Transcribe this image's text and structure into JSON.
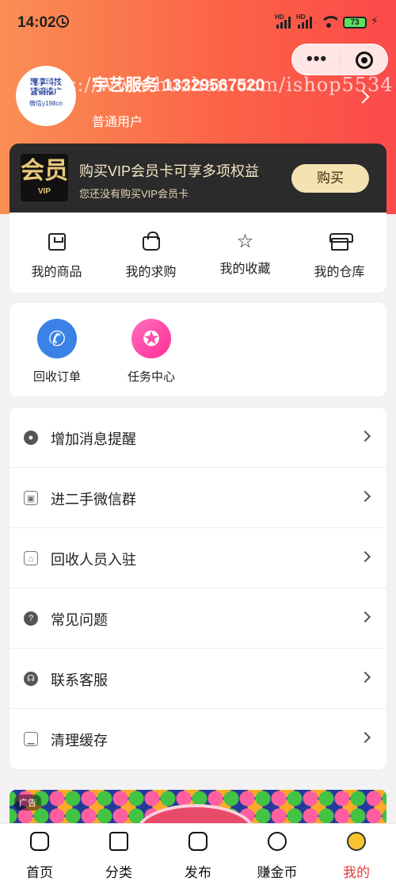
{
  "status_bar": {
    "time": "14:02",
    "hd_1": "HD",
    "hd_2": "HD",
    "battery": "73"
  },
  "capsule": {
    "more": "•••"
  },
  "profile": {
    "avatar_line1": "理享科技",
    "avatar_line2": "营销推广",
    "avatar_line3": "微信y198cn",
    "name": "宇艺服务 13329567520",
    "level": "普通用户",
    "watermark": "https://www.huzhan.com/ishop5534"
  },
  "vip": {
    "logo_main": "会员",
    "logo_sub": "VIP",
    "title": "购买VIP会员卡可享多项权益",
    "subtitle": "您还没有购买VIP会员卡",
    "button": "购买"
  },
  "quick": [
    {
      "label": "我的商品",
      "icon": "goods-icon"
    },
    {
      "label": "我的求购",
      "icon": "shopping-bag-icon"
    },
    {
      "label": "我的收藏",
      "icon": "star-icon"
    },
    {
      "label": "我的仓库",
      "icon": "store-icon"
    }
  ],
  "services": [
    {
      "label": "回收订单",
      "icon": "phone-icon",
      "color": "#3b82e6"
    },
    {
      "label": "任务中心",
      "icon": "award-icon",
      "color": "#ff3d9a"
    }
  ],
  "menu": [
    {
      "label": "增加消息提醒",
      "icon": "wechat-icon"
    },
    {
      "label": "进二手微信群",
      "icon": "group-icon"
    },
    {
      "label": "回收人员入驻",
      "icon": "shop-icon"
    },
    {
      "label": "常见问题",
      "icon": "question-icon"
    },
    {
      "label": "联系客服",
      "icon": "headset-icon"
    },
    {
      "label": "清理缓存",
      "icon": "broom-icon"
    }
  ],
  "ad": {
    "badge": "广告"
  },
  "tabbar": [
    {
      "label": "首页",
      "icon": "home-icon"
    },
    {
      "label": "分类",
      "icon": "category-icon"
    },
    {
      "label": "发布",
      "icon": "publish-icon"
    },
    {
      "label": "赚金币",
      "icon": "coin-icon"
    },
    {
      "label": "我的",
      "icon": "user-icon",
      "active": true
    }
  ],
  "colors": {
    "header_start": "#fa8f55",
    "header_end": "#fb4a4a",
    "vip_bg": "#2b2b2b",
    "vip_gold": "#f4e3b0",
    "active_tab": "#e13d3d"
  }
}
